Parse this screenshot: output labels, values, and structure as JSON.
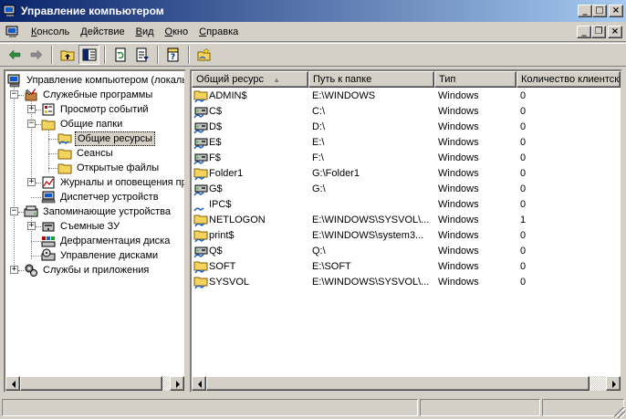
{
  "window": {
    "title": "Управление компьютером",
    "controls": [
      "minimize-icon",
      "maximize-icon",
      "close-icon"
    ]
  },
  "menu": {
    "items": [
      {
        "ul": "К",
        "rest": "онсоль"
      },
      {
        "ul": "Д",
        "rest": "ействие"
      },
      {
        "ul": "В",
        "rest": "ид"
      },
      {
        "ul": "О",
        "rest": "кно"
      },
      {
        "ul": "С",
        "rest": "правка"
      }
    ]
  },
  "toolbar": {
    "icons": [
      "back-arrow-icon",
      "forward-arrow-icon",
      "up-folder-icon",
      "show-hide-tree-icon",
      "refresh-icon",
      "export-list-icon",
      "help-icon",
      "new-share-icon"
    ]
  },
  "tree": {
    "items": [
      {
        "label": "Управление компьютером (локаль",
        "icon": "computer-management-icon"
      },
      {
        "label": "Служебные программы",
        "icon": "tools-icon"
      },
      {
        "label": "Просмотр событий",
        "icon": "event-viewer-icon"
      },
      {
        "label": "Общие папки",
        "icon": "folder-icon"
      },
      {
        "label": "Общие ресурсы",
        "icon": "shares-icon",
        "selected": true
      },
      {
        "label": "Сеансы",
        "icon": "folder-icon"
      },
      {
        "label": "Открытые файлы",
        "icon": "folder-icon"
      },
      {
        "label": "Журналы и оповещения пр",
        "icon": "logs-icon"
      },
      {
        "label": "Диспетчер устройств",
        "icon": "device-manager-icon"
      },
      {
        "label": "Запоминающие устройства",
        "icon": "storage-icon"
      },
      {
        "label": "Съемные ЗУ",
        "icon": "removable-storage-icon"
      },
      {
        "label": "Дефрагментация диска",
        "icon": "defrag-icon"
      },
      {
        "label": "Управление дисками",
        "icon": "disk-management-icon"
      },
      {
        "label": "Службы и приложения",
        "icon": "services-icon"
      }
    ]
  },
  "list": {
    "columns": [
      "Общий ресурс",
      "Путь к папке",
      "Тип",
      "Количество клиентских"
    ],
    "rows": [
      {
        "name": "ADMIN$",
        "path": "E:\\WINDOWS",
        "type": "Windows",
        "clients": "0",
        "icon": "folder-share-icon"
      },
      {
        "name": "C$",
        "path": "C:\\",
        "type": "Windows",
        "clients": "0",
        "icon": "drive-share-icon"
      },
      {
        "name": "D$",
        "path": "D:\\",
        "type": "Windows",
        "clients": "0",
        "icon": "drive-share-icon"
      },
      {
        "name": "E$",
        "path": "E:\\",
        "type": "Windows",
        "clients": "0",
        "icon": "drive-share-icon"
      },
      {
        "name": "F$",
        "path": "F:\\",
        "type": "Windows",
        "clients": "0",
        "icon": "drive-share-icon"
      },
      {
        "name": "Folder1",
        "path": "G:\\Folder1",
        "type": "Windows",
        "clients": "0",
        "icon": "folder-share-icon"
      },
      {
        "name": "G$",
        "path": "G:\\",
        "type": "Windows",
        "clients": "0",
        "icon": "drive-share-icon"
      },
      {
        "name": "IPC$",
        "path": "",
        "type": "Windows",
        "clients": "0",
        "icon": "ipc-share-icon"
      },
      {
        "name": "NETLOGON",
        "path": "E:\\WINDOWS\\SYSVOL\\...",
        "type": "Windows",
        "clients": "1",
        "icon": "folder-share-icon"
      },
      {
        "name": "print$",
        "path": "E:\\WINDOWS\\system3...",
        "type": "Windows",
        "clients": "0",
        "icon": "folder-share-icon"
      },
      {
        "name": "Q$",
        "path": "Q:\\",
        "type": "Windows",
        "clients": "0",
        "icon": "drive-share-icon"
      },
      {
        "name": "SOFT",
        "path": "E:\\SOFT",
        "type": "Windows",
        "clients": "0",
        "icon": "folder-share-icon"
      },
      {
        "name": "SYSVOL",
        "path": "E:\\WINDOWS\\SYSVOL\\...",
        "type": "Windows",
        "clients": "0",
        "icon": "folder-share-icon"
      }
    ]
  },
  "colors": {
    "titlebar_start": "#0a246a",
    "titlebar_end": "#a6caf0",
    "face": "#d4d0c8",
    "folder": "#f4d35e"
  }
}
